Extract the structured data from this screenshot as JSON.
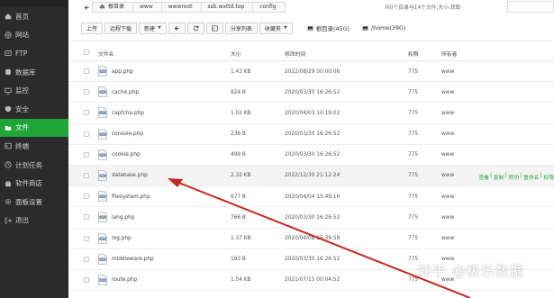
{
  "sidebar": {
    "items": [
      {
        "label": "首页",
        "icon": "home-icon",
        "active": false
      },
      {
        "label": "网站",
        "icon": "globe-icon",
        "active": false
      },
      {
        "label": "FTP",
        "icon": "ftp-icon",
        "active": false
      },
      {
        "label": "数据库",
        "icon": "database-icon",
        "active": false
      },
      {
        "label": "监控",
        "icon": "monitor-icon",
        "active": false
      },
      {
        "label": "安全",
        "icon": "shield-icon",
        "active": false
      },
      {
        "label": "文件",
        "icon": "folder-icon",
        "active": true
      },
      {
        "label": "终端",
        "icon": "terminal-icon",
        "active": false
      },
      {
        "label": "计划任务",
        "icon": "clock-icon",
        "active": false
      },
      {
        "label": "软件商店",
        "icon": "store-icon",
        "active": false
      },
      {
        "label": "面板设置",
        "icon": "gear-icon",
        "active": false
      },
      {
        "label": "退出",
        "icon": "logout-icon",
        "active": false
      }
    ],
    "accent": "#20a53a"
  },
  "path": {
    "crumbs": [
      "根目录",
      "www",
      "wwwroot",
      "ssb.wxttd.top",
      "config"
    ],
    "info": "共0个目录与14个文件,大小:获取"
  },
  "toolbar": {
    "upload": "上传",
    "remote_download": "远程下载",
    "new": "新建",
    "share_list": "分享列表",
    "favorites": "收藏夹",
    "disks": [
      "根目录(45G)",
      "/home(39G)"
    ]
  },
  "table": {
    "headers": {
      "name": "文件名",
      "size": "大小",
      "date": "修改时间",
      "perm": "权限",
      "owner": "所有者"
    },
    "rows": [
      {
        "name": "app.php",
        "size": "1.43 KB",
        "date": "2022/08/29 00:00:06",
        "perm": "775",
        "owner": "www"
      },
      {
        "name": "cache.php",
        "size": "824 B",
        "date": "2020/03/30 16:26:52",
        "perm": "775",
        "owner": "www"
      },
      {
        "name": "captcha.php",
        "size": "1.02 KB",
        "date": "2020/04/03 10:19:02",
        "perm": "775",
        "owner": "www"
      },
      {
        "name": "console.php",
        "size": "236 B",
        "date": "2020/03/30 16:26:52",
        "perm": "775",
        "owner": "www"
      },
      {
        "name": "cookie.php",
        "size": "499 B",
        "date": "2020/03/30 16:26:52",
        "perm": "775",
        "owner": "www"
      },
      {
        "name": "database.php",
        "size": "2.32 KB",
        "date": "2022/12/30 21:12:24",
        "perm": "775",
        "owner": "www",
        "ops": [
          "查看",
          "复制",
          "剪切",
          "重命名",
          "权限"
        ]
      },
      {
        "name": "filesystem.php",
        "size": "677 B",
        "date": "2020/04/04 15:49:16",
        "perm": "775",
        "owner": "www"
      },
      {
        "name": "lang.php",
        "size": "766 B",
        "date": "2020/03/30 16:26:52",
        "perm": "775",
        "owner": "www"
      },
      {
        "name": "log.php",
        "size": "1.37 KB",
        "date": "2020/04/08 15:39:58",
        "perm": "775",
        "owner": "www"
      },
      {
        "name": "middleware.php",
        "size": "193 B",
        "date": "2020/03/30 16:26:52",
        "perm": "775",
        "owner": "www"
      },
      {
        "name": "route.php",
        "size": "1.54 KB",
        "date": "2021/07/15 00:04:52",
        "perm": "775",
        "owner": "www"
      }
    ]
  },
  "watermark": "知乎 @极乐数据",
  "colors": {
    "arrow": "#c4271d",
    "link": "#20a53a"
  }
}
